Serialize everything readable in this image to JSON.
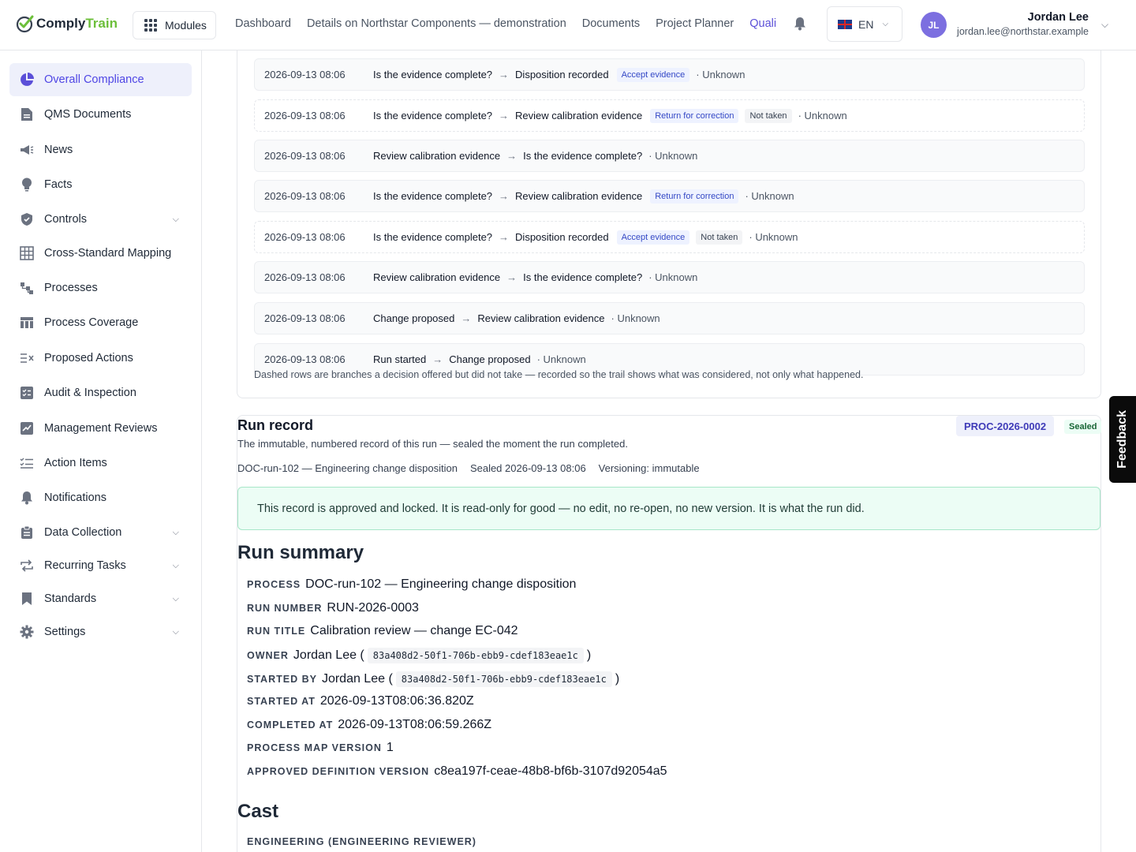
{
  "brand": {
    "name_part1": "Comply",
    "name_part2": "Train",
    "accent": "#6cbf3a"
  },
  "topbar": {
    "modules_label": "Modules",
    "nav": [
      "Dashboard",
      "Details on Northstar Components — demonstration",
      "Documents",
      "Project Planner",
      "Quali"
    ],
    "active_nav": "Quali",
    "language": "EN",
    "user": {
      "initials": "JL",
      "name": "Jordan Lee",
      "email": "jordan.lee@northstar.example"
    }
  },
  "sidebar": {
    "items": [
      {
        "label": "Overall Compliance",
        "icon": "pie-chart-icon",
        "active": true
      },
      {
        "label": "QMS Documents",
        "icon": "document-icon"
      },
      {
        "label": "News",
        "icon": "megaphone-icon"
      },
      {
        "label": "Facts",
        "icon": "lightbulb-icon"
      },
      {
        "label": "Controls",
        "icon": "shield-icon",
        "expandable": true
      },
      {
        "label": "Cross-Standard Mapping",
        "icon": "table-grid-icon"
      },
      {
        "label": "Processes",
        "icon": "process-flow-icon"
      },
      {
        "label": "Process Coverage",
        "icon": "coverage-table-icon"
      },
      {
        "label": "Proposed Actions",
        "icon": "proposed-actions-icon"
      },
      {
        "label": "Audit & Inspection",
        "icon": "checklist-icon"
      },
      {
        "label": "Management Reviews",
        "icon": "review-chart-icon"
      },
      {
        "label": "Action Items",
        "icon": "action-list-icon"
      },
      {
        "label": "Notifications",
        "icon": "bell-icon"
      },
      {
        "label": "Data Collection",
        "icon": "clipboard-icon",
        "expandable": true
      },
      {
        "label": "Recurring Tasks",
        "icon": "repeat-icon",
        "expandable": true
      },
      {
        "label": "Standards",
        "icon": "bookmark-icon",
        "expandable": true
      },
      {
        "label": "Settings",
        "icon": "gear-icon",
        "expandable": true
      }
    ]
  },
  "trail": {
    "rows": [
      {
        "ts": "2026-09-13 08:06",
        "from": "Is the evidence complete?",
        "to": "Disposition recorded",
        "badge": "Accept evidence",
        "not_taken": "",
        "who": "· Unknown",
        "dashed": false
      },
      {
        "ts": "2026-09-13 08:06",
        "from": "Is the evidence complete?",
        "to": "Review calibration evidence",
        "badge": "Return for correction",
        "not_taken": "Not taken",
        "who": "· Unknown",
        "dashed": true
      },
      {
        "ts": "2026-09-13 08:06",
        "from": "Review calibration evidence",
        "to": "Is the evidence complete?",
        "badge": "",
        "not_taken": "",
        "who": "· Unknown",
        "dashed": false
      },
      {
        "ts": "2026-09-13 08:06",
        "from": "Is the evidence complete?",
        "to": "Review calibration evidence",
        "badge": "Return for correction",
        "not_taken": "",
        "who": "· Unknown",
        "dashed": false
      },
      {
        "ts": "2026-09-13 08:06",
        "from": "Is the evidence complete?",
        "to": "Disposition recorded",
        "badge": "Accept evidence",
        "not_taken": "Not taken",
        "who": "· Unknown",
        "dashed": true
      },
      {
        "ts": "2026-09-13 08:06",
        "from": "Review calibration evidence",
        "to": "Is the evidence complete?",
        "badge": "",
        "not_taken": "",
        "who": "· Unknown",
        "dashed": false
      },
      {
        "ts": "2026-09-13 08:06",
        "from": "Change proposed",
        "to": "Review calibration evidence",
        "badge": "",
        "not_taken": "",
        "who": "· Unknown",
        "dashed": false
      },
      {
        "ts": "2026-09-13 08:06",
        "from": "Run started",
        "to": "Change proposed",
        "badge": "",
        "not_taken": "",
        "who": "· Unknown",
        "dashed": false
      }
    ],
    "note": "Dashed rows are branches a decision offered but did not take — recorded so the trail shows what was considered, not only what happened."
  },
  "run_record": {
    "title": "Run record",
    "subtitle": "The immutable, numbered record of this run — sealed the moment the run completed.",
    "proc_id": "PROC-2026-0002",
    "sealed": "Sealed",
    "meta": [
      "DOC-run-102 — Engineering change disposition",
      "Sealed 2026-09-13 08:06",
      "Versioning: immutable"
    ],
    "locked_message": "This record is approved and locked. It is read-only for good — no edit, no re-open, no new version. It is what the run did."
  },
  "summary": {
    "heading": "Run summary",
    "fields": {
      "process": {
        "k": "PROCESS",
        "v": "DOC-run-102 — Engineering change disposition"
      },
      "run_number": {
        "k": "RUN NUMBER",
        "v": "RUN-2026-0003"
      },
      "run_title": {
        "k": "RUN TITLE",
        "v": "Calibration review — change EC-042"
      },
      "owner": {
        "k": "OWNER",
        "v": "Jordan Lee (",
        "code": "83a408d2-50f1-706b-ebb9-cdef183eae1c",
        "end": ")"
      },
      "started_by": {
        "k": "STARTED BY",
        "v": "Jordan Lee (",
        "code": "83a408d2-50f1-706b-ebb9-cdef183eae1c",
        "end": ")"
      },
      "started_at": {
        "k": "STARTED AT",
        "v": "2026-09-13T08:06:36.820Z"
      },
      "completed_at": {
        "k": "COMPLETED AT",
        "v": "2026-09-13T08:06:59.266Z"
      },
      "map_version": {
        "k": "PROCESS MAP VERSION",
        "v": "1"
      },
      "def_version": {
        "k": "APPROVED DEFINITION VERSION",
        "v": "c8ea197f-ceae-48b8-bf6b-3107d92054a5"
      }
    }
  },
  "cast": {
    "heading": "Cast",
    "role_label": "ENGINEERING (ENGINEERING REVIEWER)"
  },
  "feedback_label": "Feedback"
}
